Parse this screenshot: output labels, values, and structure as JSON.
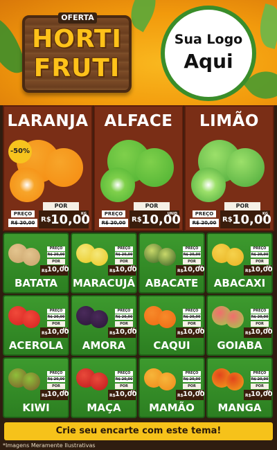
{
  "header": {
    "oferta": "OFERTA",
    "title_line1": "HORTI",
    "title_line2": "FRUTI",
    "logo_line1": "Sua Logo",
    "logo_line2": "Aqui"
  },
  "featured": [
    {
      "name": "LARANJA",
      "discount": "-50%",
      "preco_label": "PREÇO",
      "old_price": "R$ 20,00",
      "por_label": "POR",
      "currency": "R$",
      "price": "10,00",
      "unit": "KG",
      "colors": [
        "#f58a0f",
        "#f7a52a"
      ]
    },
    {
      "name": "ALFACE",
      "discount": "",
      "preco_label": "PREÇO",
      "old_price": "R$ 20,00",
      "por_label": "POR",
      "currency": "R$",
      "price": "10,00",
      "unit": "UNID",
      "colors": [
        "#4cb032",
        "#7fd04b"
      ]
    },
    {
      "name": "LIMÃO",
      "discount": "",
      "preco_label": "PREÇO",
      "old_price": "R$ 20,00",
      "por_label": "POR",
      "currency": "R$",
      "price": "10,00",
      "unit": "KG",
      "colors": [
        "#4aa83a",
        "#9ce06a"
      ]
    }
  ],
  "products": [
    {
      "name": "BATATA",
      "colors": [
        "#c9a26a",
        "#e3c48e"
      ]
    },
    {
      "name": "MARACUJÁ",
      "colors": [
        "#e9c720",
        "#f5e87a"
      ]
    },
    {
      "name": "ABACATE",
      "colors": [
        "#355f22",
        "#c9d86a"
      ]
    },
    {
      "name": "ABACAXI",
      "colors": [
        "#e8b222",
        "#f6d24c"
      ]
    },
    {
      "name": "ACEROLA",
      "colors": [
        "#d62020",
        "#f04a3a"
      ]
    },
    {
      "name": "AMORA",
      "colors": [
        "#2a1638",
        "#4a2a5a"
      ]
    },
    {
      "name": "CAQUI",
      "colors": [
        "#ef6a12",
        "#f78a2a"
      ]
    },
    {
      "name": "GOIABA",
      "colors": [
        "#9fcf4a",
        "#f26d6d"
      ]
    },
    {
      "name": "KIWI",
      "colors": [
        "#7a5a2a",
        "#8fbf3a"
      ]
    },
    {
      "name": "MAÇA",
      "colors": [
        "#c2181c",
        "#e84a3a"
      ]
    },
    {
      "name": "MAMÃO",
      "colors": [
        "#f08a1a",
        "#f6b53a"
      ]
    },
    {
      "name": "MANGA",
      "colors": [
        "#f2a41a",
        "#e2451c"
      ]
    }
  ],
  "product_price": {
    "preco_label": "PREÇO",
    "old_price": "R$ 20,00",
    "por_label": "POR",
    "currency": "R$",
    "price": "10,00",
    "unit": "KG"
  },
  "footer": {
    "banner": "Crie seu encarte com este tema!",
    "disclaimer": "*Imagens Meramente Ilustrativas"
  }
}
